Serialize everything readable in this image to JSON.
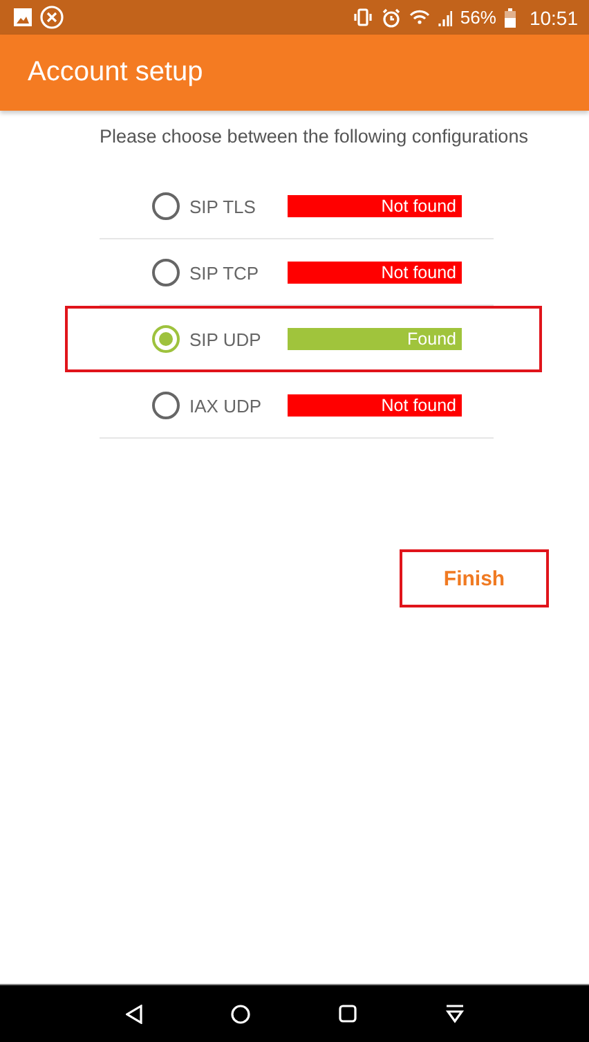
{
  "status_bar": {
    "battery_percent": "56%",
    "time": "10:51"
  },
  "app_bar": {
    "title": "Account setup"
  },
  "instruction": "Please choose between the following configurations",
  "configurations": [
    {
      "label": "SIP TLS",
      "selected": false,
      "found": false,
      "status": "Not found",
      "highlighted": false
    },
    {
      "label": "SIP TCP",
      "selected": false,
      "found": false,
      "status": "Not found",
      "highlighted": false
    },
    {
      "label": "SIP UDP",
      "selected": true,
      "found": true,
      "status": "Found",
      "highlighted": true
    },
    {
      "label": "IAX UDP",
      "selected": false,
      "found": false,
      "status": "Not found",
      "highlighted": false
    }
  ],
  "finish_button": {
    "label": "Finish",
    "highlighted": true
  }
}
